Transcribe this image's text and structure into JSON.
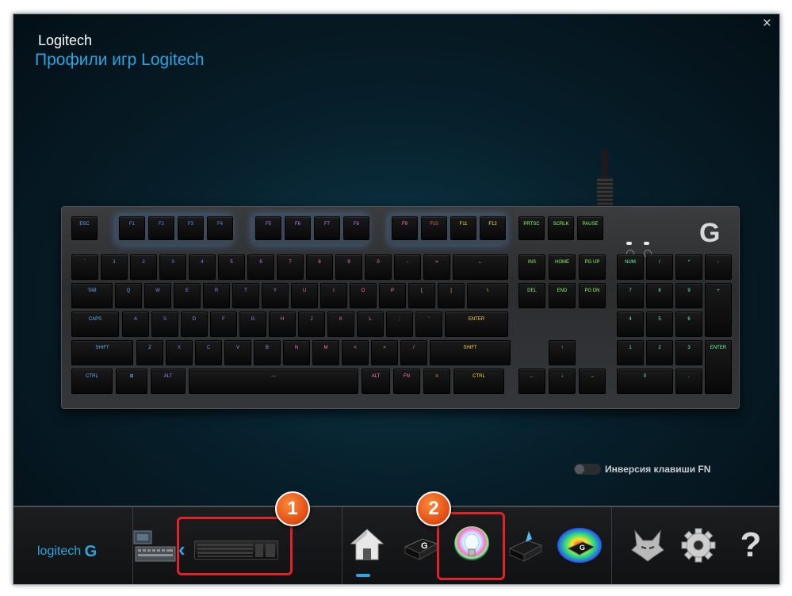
{
  "window": {
    "close_label": "×",
    "brand": "Logitech",
    "title": "Профили игр Logitech"
  },
  "keyboard": {
    "rows": [
      [
        {
          "t": "ESC"
        }
      ],
      [
        {
          "t": "F1"
        },
        {
          "t": "F2"
        },
        {
          "t": "F3"
        },
        {
          "t": "F4"
        }
      ],
      [
        {
          "t": "F5"
        },
        {
          "t": "F6"
        },
        {
          "t": "F7"
        },
        {
          "t": "F8"
        }
      ],
      [
        {
          "t": "F9"
        },
        {
          "t": "F10"
        },
        {
          "t": "F11"
        },
        {
          "t": "F12"
        }
      ],
      [
        {
          "t": "PRTSC"
        },
        {
          "t": "SCRLK"
        },
        {
          "t": "PAUSE"
        }
      ]
    ],
    "number_row": [
      "`",
      "1",
      "2",
      "3",
      "4",
      "5",
      "6",
      "7",
      "8",
      "9",
      "0",
      "-",
      "=",
      "←"
    ],
    "q_row": [
      "TAB",
      "Q",
      "W",
      "E",
      "R",
      "T",
      "Y",
      "U",
      "I",
      "O",
      "P",
      "[",
      "]",
      "\\"
    ],
    "a_row": [
      "CAPS",
      "A",
      "S",
      "D",
      "F",
      "G",
      "H",
      "J",
      "K",
      "L",
      ";",
      "'",
      "ENTER"
    ],
    "z_row": [
      "SHIFT",
      "Z",
      "X",
      "C",
      "V",
      "B",
      "N",
      "M",
      "<",
      ">",
      "/",
      "SHIFT"
    ],
    "bottom_row": [
      "CTRL",
      "⊞",
      "ALT",
      "—",
      "ALT",
      "FN",
      "≡",
      "CTRL"
    ],
    "nav_cluster": [
      "INS",
      "HOME",
      "PG UP",
      "DEL",
      "END",
      "PG DN",
      "↑",
      "←",
      "↓",
      "→"
    ],
    "numpad": [
      "NUM",
      "/",
      "*",
      "-",
      "7",
      "8",
      "9",
      "+",
      "4",
      "5",
      "6",
      "1",
      "2",
      "3",
      "ENTER",
      "0",
      "."
    ],
    "logo": "G"
  },
  "fn_toggle": {
    "label": "Инверсия клавиши FN"
  },
  "bottom": {
    "logo_text": "logitech",
    "logo_g": "G",
    "badge1": "1",
    "badge2": "2",
    "chevron": "‹",
    "help": "?"
  },
  "colors": {
    "accent": "#2aa6e0",
    "highlight": "#e0222a",
    "badge": "#e55a1b"
  }
}
